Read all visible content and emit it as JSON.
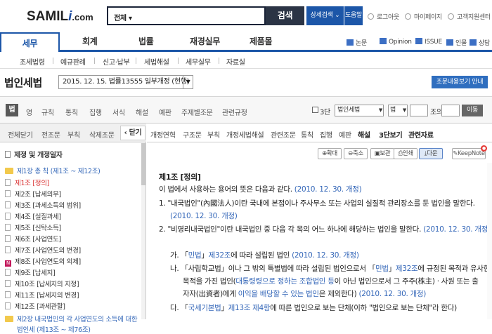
{
  "header": {
    "logo_samil": "SAMIL",
    "logo_i": "i",
    "logo_com": ".com",
    "search_scope": "전체",
    "search_button": "검색",
    "advanced_search": "상세검색",
    "help": "도움말",
    "logout": "로그아웃",
    "mypage": "마이페이지",
    "support": "고객지원센터"
  },
  "main_nav": {
    "tabs": [
      "세무",
      "회계",
      "법률",
      "재경실무",
      "제품몰"
    ],
    "right_links": [
      "논문",
      "Opinion",
      "ISSUE",
      "인물",
      "상담"
    ]
  },
  "sub_nav": [
    "조세법령",
    "예규판례",
    "신고·납부",
    "세법해설",
    "세무실무",
    "자료실"
  ],
  "title_row": {
    "title": "법인세법",
    "version": "2015. 12. 15. 법률13555 일부개정 (현행)",
    "guide_button": "조문내용보기 안내"
  },
  "filter_bar": {
    "law_tab": "법",
    "tabs": [
      "영",
      "규칙",
      "통칙",
      "집행",
      "서식",
      "해설",
      "예판",
      "주제별조문",
      "관련규정"
    ],
    "checkbox_label": "3단",
    "law_select": "법인세법",
    "bup_select": "법",
    "jo_label": "조의",
    "go_button": "이동"
  },
  "left_panel": {
    "tabs": [
      "전체닫기",
      "전조문",
      "부칙",
      "삭제조문"
    ],
    "collapse": "닫기",
    "toc_title": "제정 및 개정일자",
    "items": [
      {
        "text": "제1장 총 칙 (제1조 ~ 제12조)",
        "kind": "chapter"
      },
      {
        "text": "제1조 [정의]",
        "kind": "active"
      },
      {
        "text": "제2조 [납세의무]",
        "kind": "page"
      },
      {
        "text": "제3조 [과세소득의 범위]",
        "kind": "page"
      },
      {
        "text": "제4조 [실질과세]",
        "kind": "page"
      },
      {
        "text": "제5조 [신탁소득]",
        "kind": "page"
      },
      {
        "text": "제6조 [사업연도]",
        "kind": "page"
      },
      {
        "text": "제7조 [사업연도의 변경]",
        "kind": "page"
      },
      {
        "text": "제8조 [사업연도의 의제]",
        "kind": "new"
      },
      {
        "text": "제9조 [납세지]",
        "kind": "page"
      },
      {
        "text": "제10조 [납세지의 지정]",
        "kind": "page"
      },
      {
        "text": "제11조 [납세지의 변경]",
        "kind": "page"
      },
      {
        "text": "제12조 [과세관할]",
        "kind": "page"
      },
      {
        "text": "제2장 내국법인의 각 사업연도의 소득에 대한",
        "kind": "chapter"
      },
      {
        "text": "법인세 (제13조 ~ 제76조)",
        "kind": "chapter-cont"
      }
    ]
  },
  "article_tabs": [
    "개정연혁",
    "구조문",
    "부칙",
    "개정세법해설",
    "관련조문",
    "통칙",
    "집행",
    "예판",
    "해설",
    "3단보기",
    "관련자료"
  ],
  "tools": [
    "확대",
    "축소",
    "보관",
    "인쇄",
    "다운",
    "KeepNote"
  ],
  "article": {
    "title": "제1조 [정의]",
    "intro": "이 법에서 사용하는 용어의 뜻은 다음과 같다.",
    "date": "(2010. 12. 30. 개정)",
    "item1_a": "1. \"내국법인\"(內國法人)이란 국내에 본점이나 주사무소 또는 사업의 실질적 관리장소를 둔 법인을 말한다.",
    "item2_a": "2. \"비영리내국법인\"이란 내국법인 중 다음 각 목의 어느 하나에 해당하는 법인을 말한다.",
    "ga_a": "가. 「",
    "ga_link": "민법",
    "ga_b": "」",
    "ga_c": "제32조",
    "ga_d": "에 따라 설립된 법인",
    "na_a": "나. 「사립학교법」이나 그 밖의 특별법에 따라 설립된 법인으로서 「",
    "na_link": "민법",
    "na_b": "」",
    "na_c": "제32조",
    "na_d": "에 규정된 목적과 유사한",
    "na_e": "목적을 가진 법인(",
    "na_f": "대통령령으로 정하는 조합법인 등",
    "na_g": "이 아닌 법인으로서 그 주주(株主) · 사원 또는 출",
    "na_h": "자자(出資者)에게 ",
    "na_i": "이익을 배당할 수 있는 법인",
    "na_j": "은 제외한다)",
    "da_a": "다. 「",
    "da_link": "국세기본법",
    "da_b": "」",
    "da_c": "제13조 제4항",
    "da_d": "에 따른 법인으로 보는 단체(이하 \"법인으로 보는 단체\"라 한다)"
  }
}
